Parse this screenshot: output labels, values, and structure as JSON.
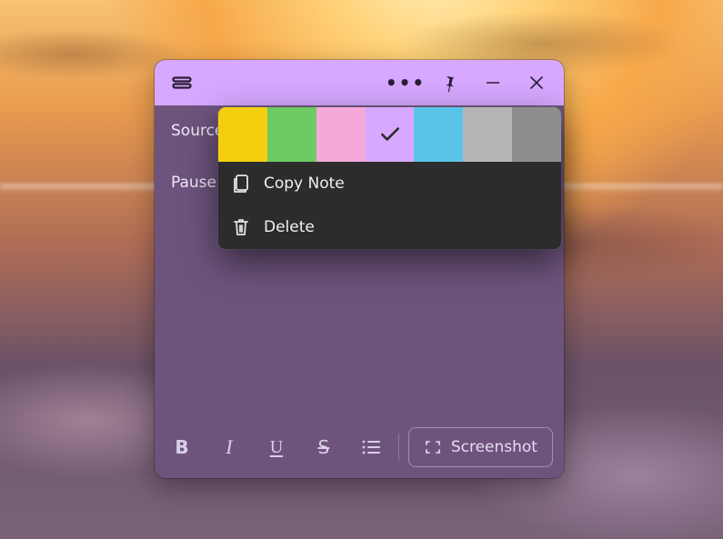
{
  "note": {
    "body_line1": "Source",
    "body_line2": "Pause",
    "accent_color": "#d6a8ff",
    "body_bg": "#6e547d"
  },
  "titlebar": {
    "drag_handle": "drag",
    "more": "•••",
    "pin_icon": "pin-icon",
    "minimize_icon": "minimize-icon",
    "close_icon": "close-icon"
  },
  "toolbar": {
    "bold_label": "B",
    "italic_label": "I",
    "underline_label": "U",
    "strike_label": "S",
    "bullets_icon": "list-icon",
    "screenshot_label": "Screenshot",
    "screenshot_icon": "screenshot-icon"
  },
  "menu": {
    "colors": [
      {
        "name": "yellow",
        "hex": "#f4cf0d",
        "selected": false
      },
      {
        "name": "green",
        "hex": "#6ecb63",
        "selected": false
      },
      {
        "name": "pink",
        "hex": "#f4a9da",
        "selected": false
      },
      {
        "name": "purple",
        "hex": "#d6a8ff",
        "selected": true
      },
      {
        "name": "blue",
        "hex": "#5ac3e8",
        "selected": false
      },
      {
        "name": "grey",
        "hex": "#b5b5b5",
        "selected": false
      },
      {
        "name": "darkgrey",
        "hex": "#8d8d8d",
        "selected": false
      }
    ],
    "items": [
      {
        "id": "copy",
        "icon": "copy-icon",
        "label": "Copy Note"
      },
      {
        "id": "delete",
        "icon": "trash-icon",
        "label": "Delete"
      }
    ]
  }
}
